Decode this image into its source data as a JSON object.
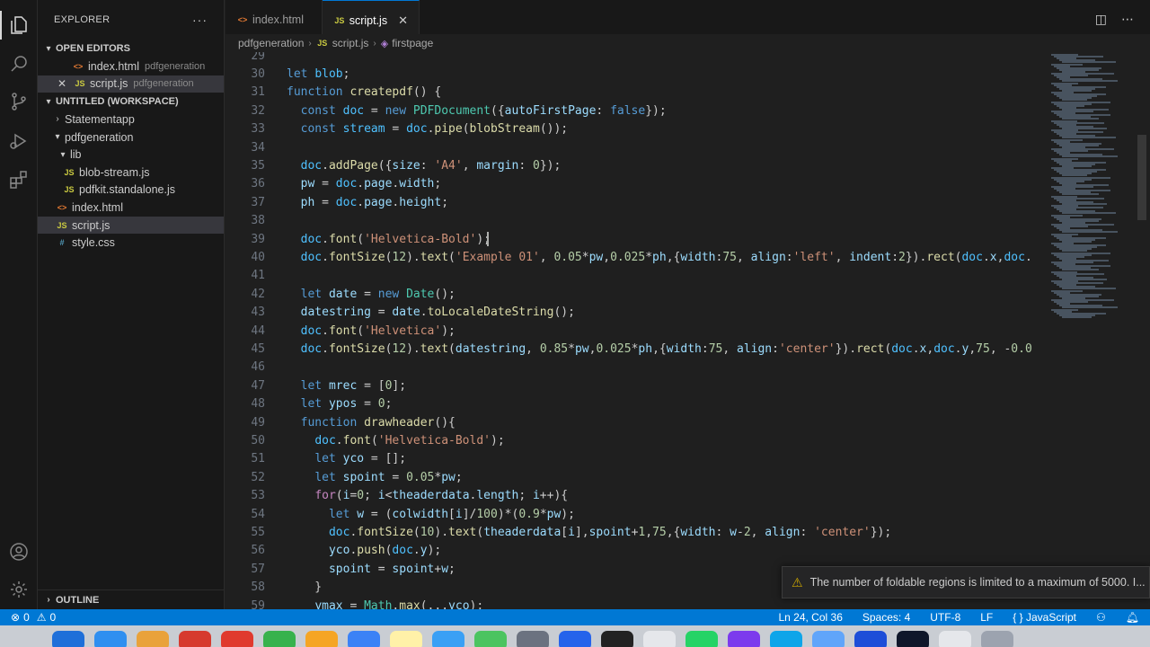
{
  "sidebar": {
    "title": "EXPLORER",
    "more": "···",
    "open_editors": {
      "label": "OPEN EDITORS",
      "items": [
        {
          "name": "index.html",
          "folder": "pdfgeneration",
          "type": "html"
        },
        {
          "name": "script.js",
          "folder": "pdfgeneration",
          "type": "js"
        }
      ]
    },
    "workspace": {
      "label": "UNTITLED (WORKSPACE)",
      "items": [
        {
          "name": "Statementapp"
        },
        {
          "name": "pdfgeneration"
        },
        {
          "name": "lib"
        },
        {
          "name": "blob-stream.js"
        },
        {
          "name": "pdfkit.standalone.js"
        },
        {
          "name": "index.html"
        },
        {
          "name": "script.js"
        },
        {
          "name": "style.css"
        }
      ]
    },
    "outline_label": "OUTLINE"
  },
  "tabs": [
    {
      "label": "index.html",
      "type": "html"
    },
    {
      "label": "script.js",
      "type": "js"
    }
  ],
  "breadcrumb": [
    "pdfgeneration",
    "script.js",
    "firstpage"
  ],
  "file_icons": {
    "js": "JS",
    "html": "<>",
    "css": "#"
  },
  "editor": {
    "first_line": 29,
    "lines": [
      "",
      "let blob;",
      "function createpdf() {",
      "  const doc = new PDFDocument({autoFirstPage: false});",
      "  const stream = doc.pipe(blobStream());",
      "",
      "  doc.addPage({size: 'A4', margin: 0});",
      "  pw = doc.page.width;",
      "  ph = doc.page.height;",
      "",
      "  doc.font('Helvetica-Bold');",
      "  doc.fontSize(12).text('Example 01', 0.05*pw,0.025*ph,{width:75, align:'left', indent:2}).rect(doc.x,doc.",
      "",
      "  let date = new Date();",
      "  datestring = date.toLocaleDateString();",
      "  doc.font('Helvetica');",
      "  doc.fontSize(12).text(datestring, 0.85*pw,0.025*ph,{width:75, align:'center'}).rect(doc.x,doc.y,75, -0.0",
      "",
      "  let mrec = [0];",
      "  let ypos = 0;",
      "  function drawheader(){",
      "    doc.font('Helvetica-Bold');",
      "    let yco = [];",
      "    let spoint = 0.05*pw;",
      "    for(i=0; i<theaderdata.length; i++){",
      "      let w = (colwidth[i]/100)*(0.9*pw);",
      "      doc.fontSize(10).text(theaderdata[i],spoint+1,75,{width: w-2, align: 'center'});",
      "      yco.push(doc.y);",
      "      spoint = spoint+w;",
      "    }",
      "    ymax = Math.max(...yco);"
    ]
  },
  "notification": "The number of foldable regions is limited to a maximum of 5000. I...",
  "status": {
    "errors": "0",
    "warnings": "0",
    "position": "Ln 24, Col 36",
    "spaces": "Spaces: 4",
    "encoding": "UTF-8",
    "eol": "LF",
    "language": "JavaScript",
    "language_icon": "{ }"
  }
}
